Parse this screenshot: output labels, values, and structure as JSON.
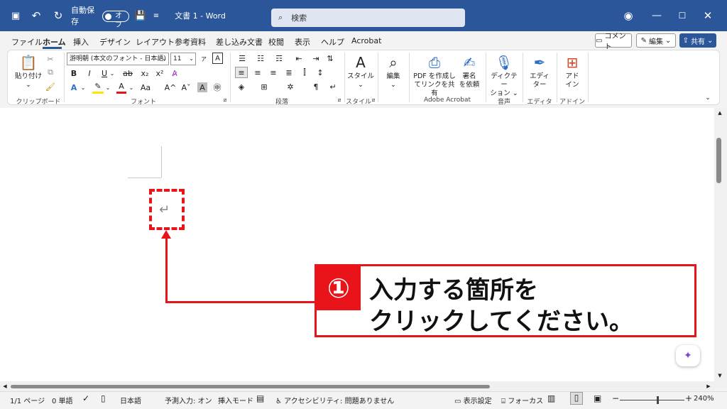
{
  "titlebar": {
    "autosave_label": "自動保存",
    "autosave_state": "オフ",
    "doc_title": "文書 1  -  Word",
    "search_placeholder": "検索",
    "icons": [
      "save-icon",
      "undo-icon",
      "redo-icon",
      "customize-icon",
      "user-icon",
      "minimize-icon",
      "maximize-icon",
      "close-icon"
    ]
  },
  "menu": {
    "tabs": [
      "ファイル",
      "ホーム",
      "挿入",
      "デザイン",
      "レイアウト",
      "参考資料",
      "差し込み文書",
      "校閲",
      "表示",
      "ヘルプ",
      "Acrobat"
    ],
    "active_tab": "ホーム",
    "comment_label": "コメント",
    "edit_label": "編集",
    "share_label": "共有"
  },
  "ribbon": {
    "clipboard": {
      "paste_label": "貼り付け",
      "group_label": "クリップボード"
    },
    "font": {
      "font_name": "游明朝 (本文のフォント - 日本語)",
      "font_size": "11",
      "group_label": "フォント",
      "buttons": [
        "B",
        "I",
        "U",
        "ab",
        "x₂",
        "x²"
      ]
    },
    "paragraph": {
      "group_label": "段落"
    },
    "styles": {
      "styles_label": "スタイル",
      "group_label": "スタイル"
    },
    "editing": {
      "label": "編集"
    },
    "acrobat": {
      "pdf_label_1": "PDF を作成し",
      "pdf_label_2": "てリンクを共有",
      "sign_label_1": "署名",
      "sign_label_2": "を依頼",
      "group_label": "Adobe Acrobat"
    },
    "voice": {
      "dictate_label_1": "ディクテー",
      "dictate_label_2": "ション",
      "group_label": "音声"
    },
    "editor": {
      "label_1": "エディ",
      "label_2": "ター",
      "group_label": "エディター"
    },
    "addins": {
      "label_1": "アド",
      "label_2": "イン",
      "group_label": "アドイン"
    }
  },
  "callout": {
    "number": "①",
    "line1": "入力する箇所を",
    "line2": "クリックしてください。",
    "color": "#e8141a"
  },
  "statusbar": {
    "page": "1/1 ページ",
    "words": "0 単語",
    "language": "日本語",
    "predictive": "予測入力: オン",
    "insert_mode": "挿入モード",
    "accessibility": "アクセシビリティ: 問題ありません",
    "display_settings": "表示設定",
    "focus": "フォーカス",
    "zoom": "240%"
  },
  "colors": {
    "title_bar": "#2b579a",
    "accent_red": "#e8141a"
  }
}
